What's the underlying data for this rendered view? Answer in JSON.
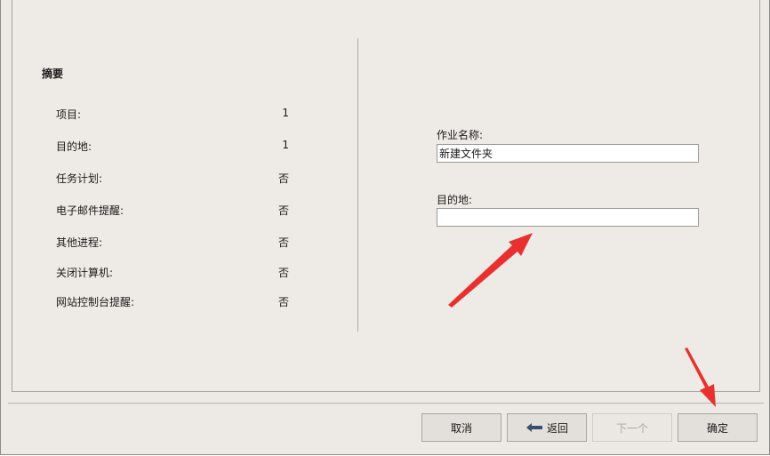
{
  "summary": {
    "title": "摘要",
    "rows": [
      {
        "label": "项目:",
        "value": "1"
      },
      {
        "label": "目的地:",
        "value": "1"
      },
      {
        "label": "任务计划:",
        "value": "否"
      },
      {
        "label": "电子邮件提醒:",
        "value": "否"
      },
      {
        "label": "其他进程:",
        "value": "否"
      },
      {
        "label": "关闭计算机:",
        "value": "否"
      },
      {
        "label": "网站控制台提醒:",
        "value": "否"
      }
    ]
  },
  "form": {
    "job_name_label": "作业名称:",
    "job_name_value": "新建文件夹",
    "destination_label": "目的地:",
    "destination_value": ""
  },
  "buttons": {
    "cancel": "取消",
    "back": "返回",
    "next": "下一个",
    "ok": "确定"
  },
  "colors": {
    "annotation_arrow": "#e8312f",
    "back_arrow": "#3a4f6e"
  }
}
